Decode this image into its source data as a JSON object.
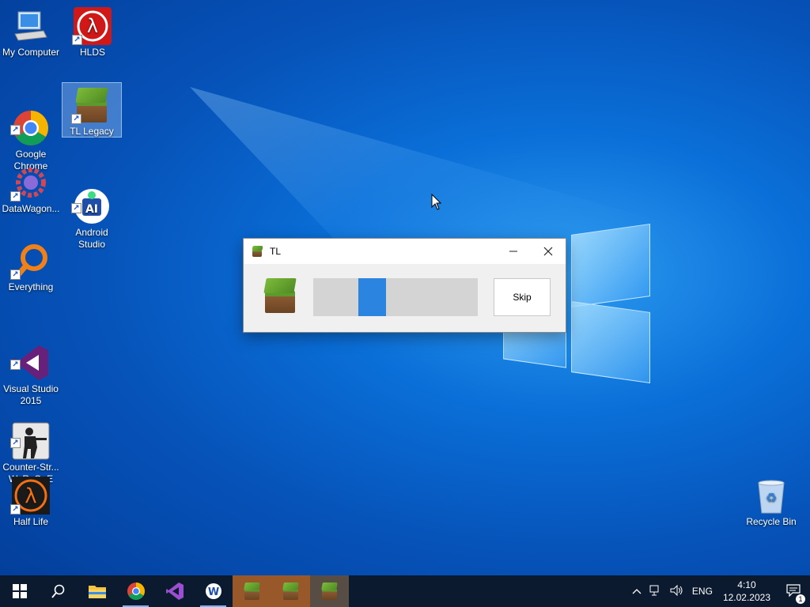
{
  "desktop": {
    "icons": [
      {
        "label": "My Computer"
      },
      {
        "label": "HLDS"
      },
      {
        "label": "Google\nChrome"
      },
      {
        "label": "TL Legacy"
      },
      {
        "label": "DataWagon..."
      },
      {
        "label": "Android\nStudio"
      },
      {
        "label": "Everything"
      },
      {
        "label": "Visual Studio\n2015"
      },
      {
        "label": "Counter-Str...\nWaRzOnE"
      },
      {
        "label": "Half Life"
      },
      {
        "label": "Recycle Bin"
      }
    ]
  },
  "dialog": {
    "title": "TL",
    "skip_label": "Skip",
    "progress_indeterminate": true
  },
  "taskbar": {
    "items": [
      "start-icon",
      "search-icon",
      "file-explorer-icon",
      "chrome-icon",
      "visual-studio-icon",
      "wagon-app-icon",
      "tl-legacy-icon",
      "tl-legacy-icon",
      "tl-legacy-icon"
    ]
  },
  "tray": {
    "language": "ENG",
    "time": "4:10",
    "date": "12.02.2023",
    "notification_count": "1"
  },
  "colors": {
    "accent": "#2a84e0",
    "taskbar": "#0b1a2e"
  }
}
